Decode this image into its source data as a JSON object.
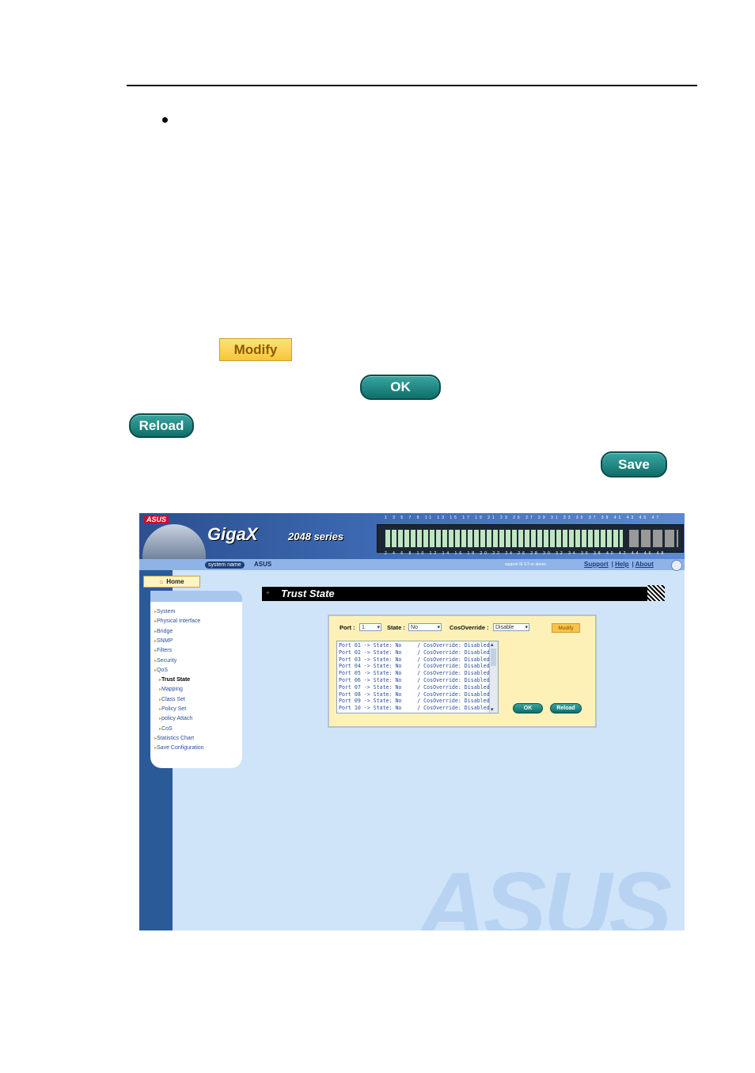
{
  "doc": {
    "modify_label": "Modify",
    "ok_label": "OK",
    "reload_label": "Reload",
    "save_label": "Save"
  },
  "banner": {
    "brand": "ASUS",
    "product": "GigaX",
    "series": "2048 series",
    "port_numbers_top": "1 3 5 7 9 11 13 15 17 19 21 23 25 27 29 31 33 35 37 39 41 43 45 47",
    "port_numbers_bottom": "2 4 6 8 10 12 14 16 18 20 22 24 26 28 30 32 34 36 38 40 42 44 46 48"
  },
  "header": {
    "system_name_label": "system name",
    "system_name_value": "ASUS",
    "support_note": "support IE 5.5 or above",
    "links": [
      "Support",
      "Help",
      "About"
    ]
  },
  "sidebar": {
    "home_label": "Home",
    "items": [
      {
        "label": "System",
        "sub": false,
        "active": false
      },
      {
        "label": "Physical Interface",
        "sub": false,
        "active": false
      },
      {
        "label": "Bridge",
        "sub": false,
        "active": false
      },
      {
        "label": "SNMP",
        "sub": false,
        "active": false
      },
      {
        "label": "Filters",
        "sub": false,
        "active": false
      },
      {
        "label": "Security",
        "sub": false,
        "active": false
      },
      {
        "label": "QoS",
        "sub": false,
        "active": false
      },
      {
        "label": "Trust State",
        "sub": true,
        "active": true
      },
      {
        "label": "Mapping",
        "sub": true,
        "active": false
      },
      {
        "label": "Class Set",
        "sub": true,
        "active": false
      },
      {
        "label": "Policy Set",
        "sub": true,
        "active": false
      },
      {
        "label": "policy Attach",
        "sub": true,
        "active": false
      },
      {
        "label": "CoS",
        "sub": true,
        "active": false
      },
      {
        "label": "Statistics Chart",
        "sub": false,
        "active": false
      },
      {
        "label": "Save Configuration",
        "sub": false,
        "active": false
      }
    ]
  },
  "main": {
    "title": "Trust State",
    "port_label": "Port :",
    "port_value": "1",
    "state_label": "State :",
    "state_value": "No",
    "cos_label": "CosOverride :",
    "cos_value": "Disable",
    "modify_label": "Modify",
    "ok_label": "OK",
    "reload_label": "Reload",
    "rows": [
      "Port 01 -> State: No     / CosOverride: Disabled",
      "Port 02 -> State: No     / CosOverride: Disabled",
      "Port 03 -> State: No     / CosOverride: Disabled",
      "Port 04 -> State: No     / CosOverride: Disabled",
      "Port 05 -> State: No     / CosOverride: Disabled",
      "Port 06 -> State: No     / CosOverride: Disabled",
      "Port 07 -> State: No     / CosOverride: Disabled",
      "Port 08 -> State: No     / CosOverride: Disabled",
      "Port 09 -> State: No     / CosOverride: Disabled",
      "Port 10 -> State: No     / CosOverride: Disabled"
    ]
  },
  "watermark": "ASUS",
  "colors": {
    "banner_blue": "#2c4f8f",
    "page_bg": "#cfe4f8",
    "teal_button": "#0f6e6a",
    "modify_yellow": "#f7c44b"
  }
}
